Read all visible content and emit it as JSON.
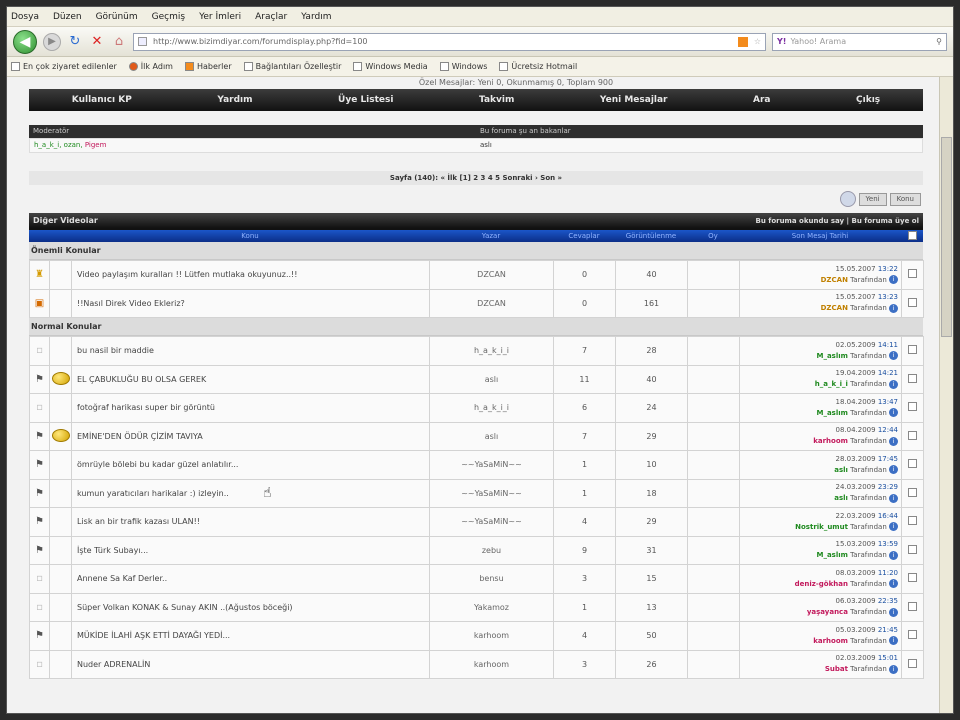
{
  "menu": [
    "Dosya",
    "Düzen",
    "Görünüm",
    "Geçmiş",
    "Yer İmleri",
    "Araçlar",
    "Yardım"
  ],
  "url": "http://www.bizimdiyar.com/forumdisplay.php?fid=100",
  "search_placeholder": "Yahoo! Arama",
  "bookmarks": [
    "En çok ziyaret edilenler",
    "İlk Adım",
    "Haberler",
    "Bağlantıları Özelleştir",
    "Windows Media",
    "Windows",
    "Ücretsiz Hotmail"
  ],
  "stats": "Özel Mesajlar: Yeni 0, Okunmamış 0, Toplam 900",
  "mainnav": [
    "Kullanıcı KP",
    "Yardım",
    "Üye Listesi",
    "Takvim",
    "Yeni Mesajlar",
    "Ara",
    "Çıkış"
  ],
  "moderators": {
    "head": "Moderatör",
    "head2": "Bu foruma şu an bakanlar",
    "names": "h_a_k_i, ozan,",
    "highlight": "Pigem",
    "viewing": "aslı"
  },
  "pager": "Sayfa (140): « İlk [1] 2 3 4 5 Sonraki › Son »",
  "buttons": [
    "Yeni",
    "Konu"
  ],
  "table_title": "Diğer Videolar",
  "table_title_right": "Bu foruma okundu say | Bu foruma üye ol",
  "columns": [
    "",
    "",
    "Konu",
    "Yazar",
    "Cevaplar",
    "Görüntülenme",
    "Oy",
    "Son Mesaj Tarihi",
    ""
  ],
  "sections": {
    "sticky": "Önemli Konular",
    "normal": "Normal Konular"
  },
  "sticky_rows": [
    {
      "icon": "sticky",
      "title": "Video paylaşım kuralları !! Lütfen mutlaka okuyunuz..!!",
      "author": "DZCAN",
      "replies": "0",
      "views": "40",
      "date": "15.05.2007",
      "time": "13:22",
      "user": "DZCAN",
      "by": "Tarafından",
      "ucolor": "#c08000"
    },
    {
      "icon": "sticky2",
      "title": "!!Nasıl Direk Video Ekleriz?",
      "author": "DZCAN",
      "replies": "0",
      "views": "161",
      "date": "15.05.2007",
      "time": "13:23",
      "user": "DZCAN",
      "by": "Tarafından",
      "ucolor": "#c08000"
    }
  ],
  "rows": [
    {
      "icon": "none",
      "smile": false,
      "title": "bu nasil bir maddie",
      "author": "h_a_k_i_i",
      "replies": "7",
      "views": "28",
      "date": "02.05.2009",
      "time": "14:11",
      "user": "M_aslım",
      "ucolor": "#1f8a1f"
    },
    {
      "icon": "hot",
      "smile": true,
      "title": "EL ÇABUKLUĞU BU OLSA GEREK",
      "author": "aslı",
      "replies": "11",
      "views": "40",
      "date": "19.04.2009",
      "time": "14:21",
      "user": "h_a_k_i_i",
      "ucolor": "#1f8a1f"
    },
    {
      "icon": "none",
      "smile": false,
      "title": "fotoğraf harikası super bir görüntü",
      "author": "h_a_k_i_i",
      "replies": "6",
      "views": "24",
      "date": "18.04.2009",
      "time": "13:47",
      "user": "M_aslım",
      "ucolor": "#1f8a1f"
    },
    {
      "icon": "hot",
      "smile": true,
      "title": "EMİNE'DEN ÖDÜR ÇİZİM TAVIYA",
      "author": "aslı",
      "replies": "7",
      "views": "29",
      "date": "08.04.2009",
      "time": "12:44",
      "user": "karhoom",
      "ucolor": "#c2185b"
    },
    {
      "icon": "hot",
      "smile": false,
      "title": "ömrüyle bölebi bu kadar güzel anlatılır...",
      "author": "~~YaSaMiN~~",
      "replies": "1",
      "views": "10",
      "date": "28.03.2009",
      "time": "17:45",
      "user": "aslı",
      "ucolor": "#1f8a1f"
    },
    {
      "icon": "hot",
      "smile": false,
      "title": "kumun yaratıcıları harikalar :) izleyin..",
      "author": "~~YaSaMiN~~",
      "replies": "1",
      "views": "18",
      "date": "24.03.2009",
      "time": "23:29",
      "user": "aslı",
      "ucolor": "#1f8a1f"
    },
    {
      "icon": "hot",
      "smile": false,
      "title": "Lisk an bir trafik kazası ULAN!!",
      "author": "~~YaSaMiN~~",
      "replies": "4",
      "views": "29",
      "date": "22.03.2009",
      "time": "16:44",
      "user": "Nostrik_umut",
      "ucolor": "#1f8a1f"
    },
    {
      "icon": "hot",
      "smile": false,
      "title": "İşte Türk Subayı...",
      "author": "zebu",
      "replies": "9",
      "views": "31",
      "date": "15.03.2009",
      "time": "13:59",
      "user": "M_aslım",
      "ucolor": "#1f8a1f"
    },
    {
      "icon": "none",
      "smile": false,
      "title": "Annene Sa Kaf Derler..",
      "author": "bensu",
      "replies": "3",
      "views": "15",
      "date": "08.03.2009",
      "time": "11:20",
      "user": "deniz-gökhan",
      "ucolor": "#c2185b"
    },
    {
      "icon": "none",
      "smile": false,
      "title": "Süper Volkan KONAK & Sunay AKIN ..(Ağustos böceği)",
      "author": "Yakamoz",
      "replies": "1",
      "views": "13",
      "date": "06.03.2009",
      "time": "22:35",
      "user": "yaşayanca",
      "ucolor": "#c2185b"
    },
    {
      "icon": "hot",
      "smile": false,
      "title": "MÜKİDE İLAHİ AŞK ETTİ DAYAĞI YEDİ...",
      "author": "karhoom",
      "replies": "4",
      "views": "50",
      "date": "05.03.2009",
      "time": "21:45",
      "user": "karhoom",
      "ucolor": "#c2185b"
    },
    {
      "icon": "none",
      "smile": false,
      "title": "Nuder ADRENALİN",
      "author": "karhoom",
      "replies": "3",
      "views": "26",
      "date": "02.03.2009",
      "time": "15:01",
      "user": "Subat",
      "ucolor": "#c2185b"
    }
  ],
  "by_label": "Tarafından"
}
